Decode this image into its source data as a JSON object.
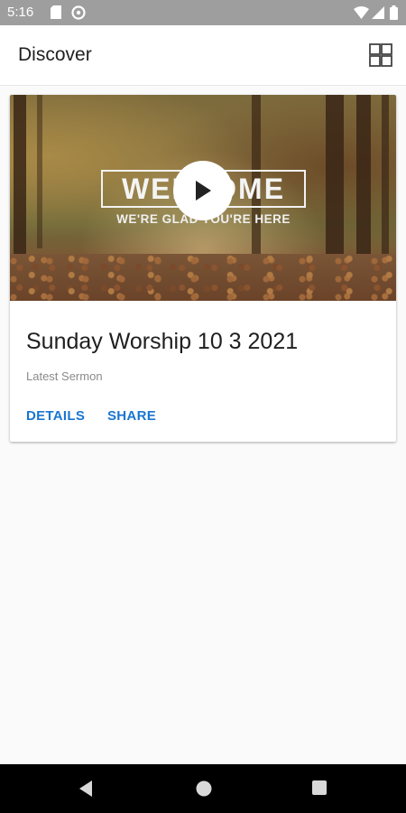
{
  "status_bar": {
    "time": "5:16",
    "icons": [
      "sd-card-icon",
      "sync-icon",
      "wifi-icon",
      "signal-icon",
      "battery-icon"
    ]
  },
  "app_bar": {
    "title": "Discover",
    "action_icon": "grid-view-icon"
  },
  "card": {
    "thumbnail": {
      "headline": "WELCOME",
      "tagline": "WE'RE GLAD YOU'RE HERE",
      "overlay_icon": "play-icon"
    },
    "title": "Sunday Worship 10 3 2021",
    "subtitle": "Latest Sermon",
    "actions": [
      {
        "label": "DETAILS"
      },
      {
        "label": "SHARE"
      }
    ],
    "action_color": "#1976d2"
  },
  "nav_bar": {
    "buttons": [
      "back-icon",
      "home-icon",
      "recents-icon"
    ]
  }
}
